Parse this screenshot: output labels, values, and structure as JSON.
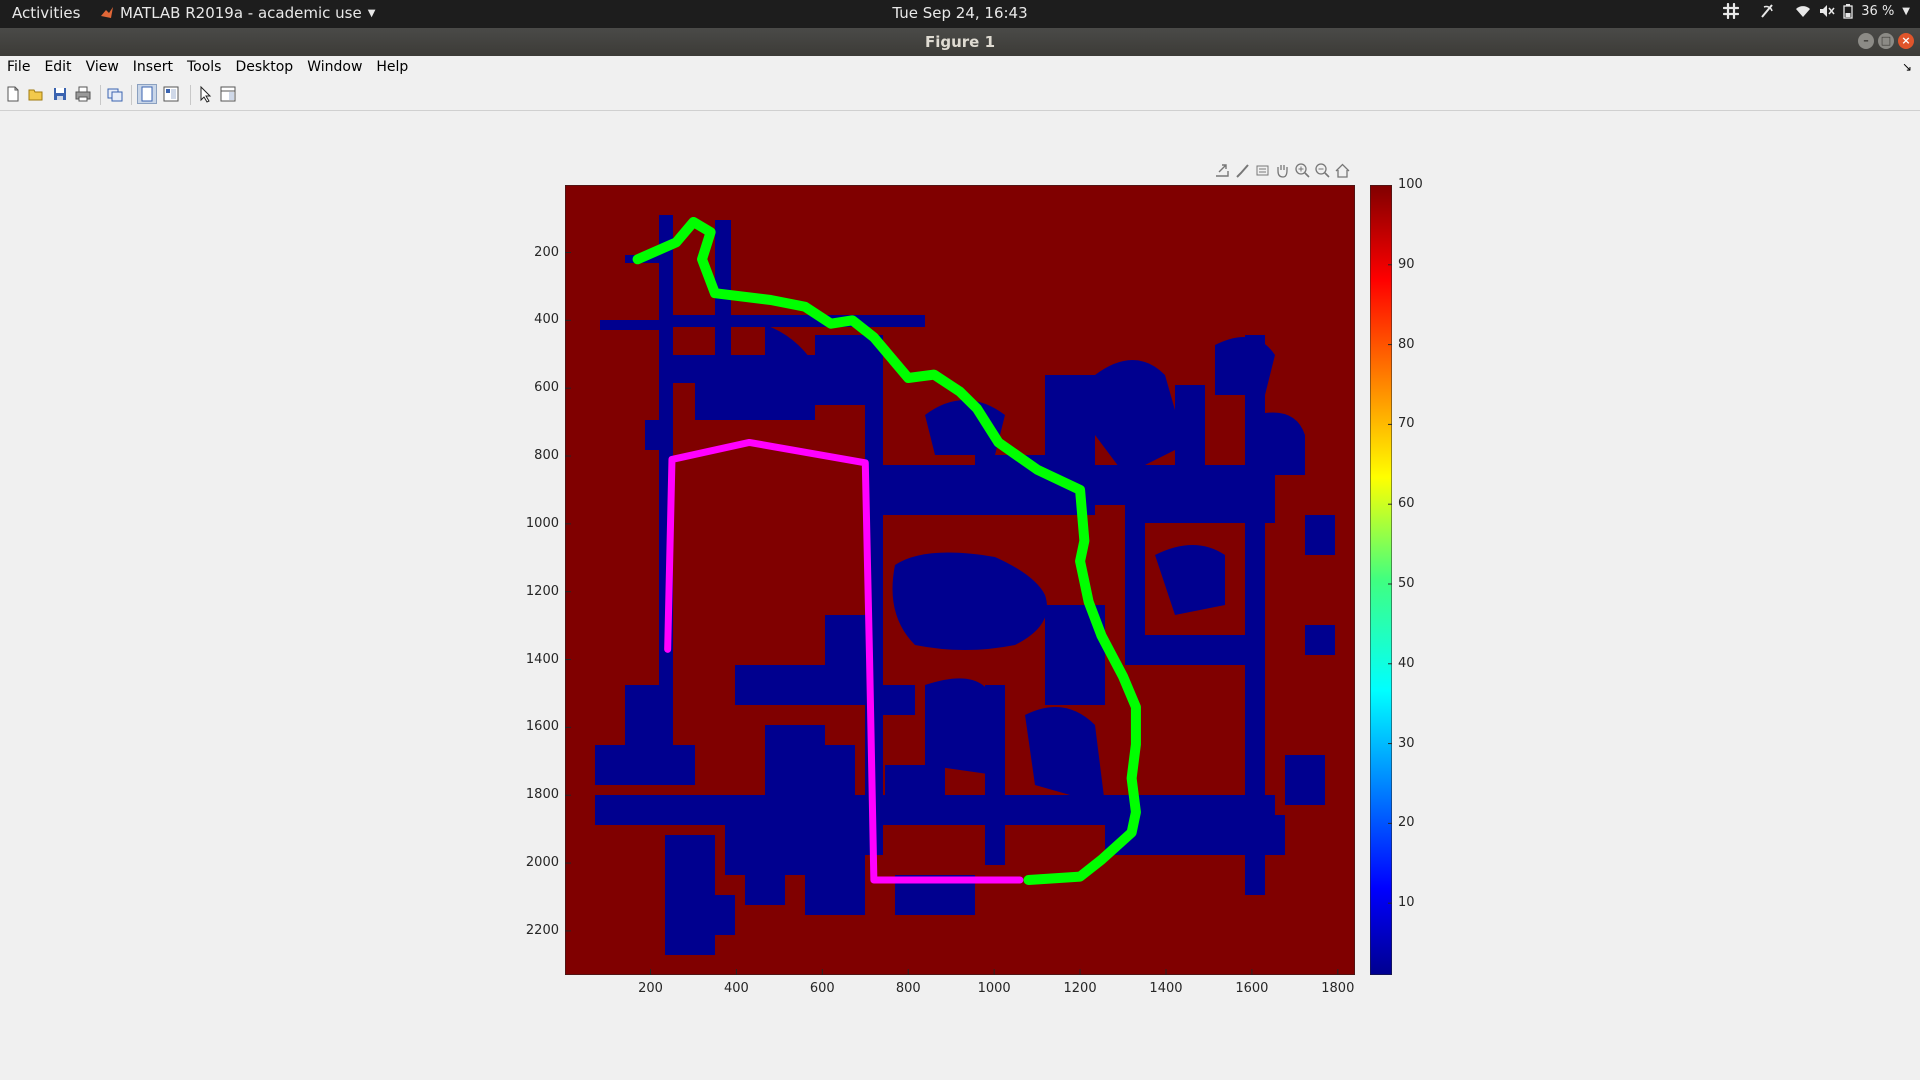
{
  "topbar": {
    "activities": "Activities",
    "app_menu": "MATLAB R2019a - academic use",
    "clock": "Tue Sep 24, 16:43",
    "battery": "36 %"
  },
  "window": {
    "title": "Figure 1"
  },
  "menu": {
    "file": "File",
    "edit": "Edit",
    "view": "View",
    "insert": "Insert",
    "tools": "Tools",
    "desktop": "Desktop",
    "window": "Window",
    "help": "Help"
  },
  "toolbar_icons": [
    "new-figure-icon",
    "open-file-icon",
    "save-icon",
    "print-icon",
    "link-plot-icon",
    "hide-plot-tools-icon",
    "show-plot-tools-icon",
    "edit-plot-icon",
    "property-inspector-icon"
  ],
  "axes_toolbar_icons": [
    "export-icon",
    "brush-icon",
    "datatip-icon",
    "pan-icon",
    "zoom-in-icon",
    "zoom-out-icon",
    "home-icon"
  ],
  "chart_data": {
    "type": "heatmap",
    "description": "occupancy map",
    "xlim": [
      1,
      1840
    ],
    "ylim": [
      2330,
      1
    ],
    "x_ticks": [
      200,
      400,
      600,
      800,
      1000,
      1200,
      1400,
      1600,
      1800
    ],
    "y_ticks": [
      200,
      400,
      600,
      800,
      1000,
      1200,
      1400,
      1600,
      1800,
      2000,
      2200
    ],
    "y_tick_labels": [
      "200",
      "400",
      "600",
      "800",
      "1000",
      "1200",
      "1400",
      "1600",
      "1800",
      "2000",
      "2200"
    ],
    "x_tick_labels": [
      "200",
      "400",
      "600",
      "800",
      "1000",
      "1200",
      "1400",
      "1600",
      "1800"
    ],
    "colormap": "jet",
    "colorbar": {
      "range": [
        1,
        100
      ],
      "ticks": [
        10,
        20,
        30,
        40,
        50,
        60,
        70,
        80,
        90,
        100
      ],
      "tick_labels": [
        "10",
        "20",
        "30",
        "40",
        "50",
        "60",
        "70",
        "80",
        "90",
        "100"
      ]
    },
    "background_value": 100,
    "background_color": "#800000",
    "free_space_color": "#00008f",
    "series": [
      {
        "color": "#00ff00",
        "x": [
          170,
          260,
          300,
          340,
          320,
          350,
          480,
          560,
          620,
          670,
          720,
          800,
          860,
          920,
          960,
          1010,
          1100,
          1200,
          1210,
          1200,
          1220,
          1250,
          1300,
          1330,
          1330,
          1320,
          1330,
          1320,
          1250,
          1200,
          1080
        ],
        "y": [
          220,
          170,
          110,
          140,
          220,
          320,
          340,
          360,
          410,
          400,
          450,
          570,
          560,
          610,
          660,
          760,
          840,
          900,
          1050,
          1110,
          1230,
          1330,
          1450,
          1540,
          1650,
          1750,
          1850,
          1910,
          1990,
          2040,
          2050
        ]
      },
      {
        "color": "#ff00ff",
        "x": [
          240,
          250,
          430,
          700,
          710,
          720,
          1060
        ],
        "y": [
          1370,
          810,
          760,
          820,
          1400,
          2050,
          2050
        ]
      }
    ]
  }
}
